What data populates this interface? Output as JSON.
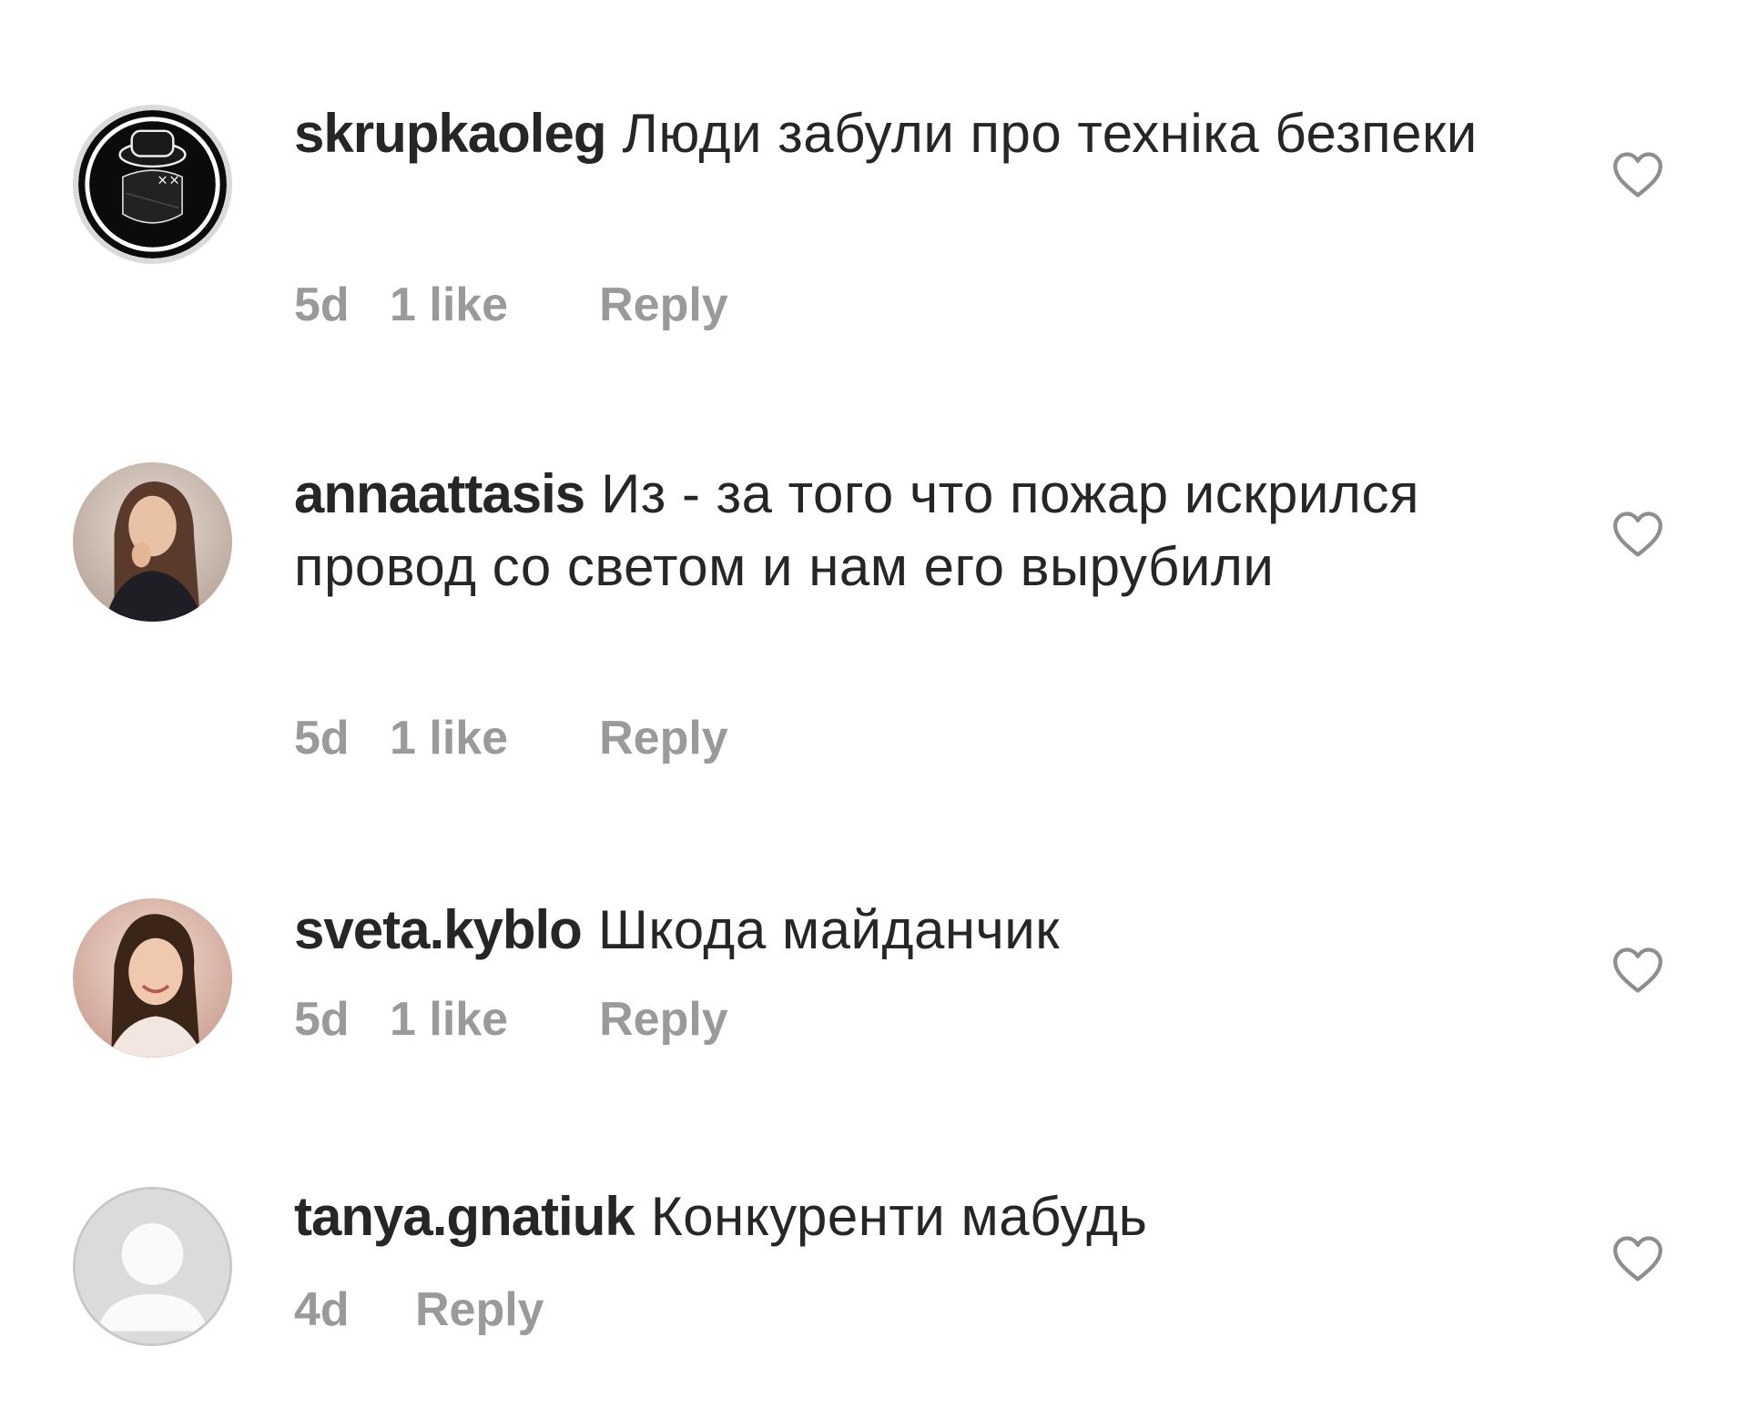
{
  "comments": [
    {
      "username": "skrupkaoleg",
      "text": "Люди забули про техніка безпеки",
      "time": "5d",
      "likes": "1 like",
      "reply": "Reply",
      "avatar": "masked-figure-avatar",
      "heart_icon": "heart-outline-icon"
    },
    {
      "username": "annaattasis",
      "text": "Из - за того что пожар искрился  провод со светом и нам его вырубили",
      "time": "5d",
      "likes": "1 like",
      "reply": "Reply",
      "avatar": "user-photo-avatar",
      "heart_icon": "heart-outline-icon"
    },
    {
      "username": "sveta.kyblo",
      "text": "Шкода майданчик",
      "time": "5d",
      "likes": "1 like",
      "reply": "Reply",
      "avatar": "user-photo-avatar",
      "heart_icon": "heart-outline-icon"
    },
    {
      "username": "tanya.gnatiuk",
      "text": "Конкуренти мабудь",
      "time": "4d",
      "likes": "",
      "reply": "Reply",
      "avatar": "default-profile-avatar",
      "heart_icon": "heart-outline-icon"
    }
  ],
  "colors": {
    "text": "#262626",
    "meta": "#9a9a9a",
    "heart": "#8e8e8e",
    "background": "#ffffff"
  }
}
